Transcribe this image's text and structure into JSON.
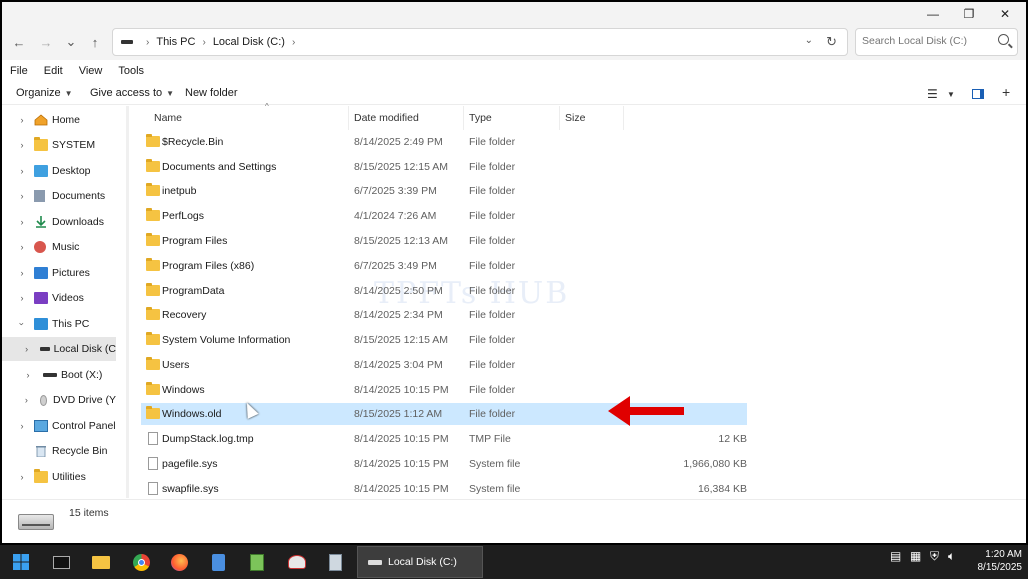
{
  "window": {
    "caption": {
      "minimize": "—",
      "maximize": "❐",
      "close": "✕"
    }
  },
  "nav": {
    "back": "←",
    "forward": "→",
    "recent": "⌄",
    "up": "↑"
  },
  "address": {
    "crumbs": [
      "This PC",
      "Local Disk (C:)"
    ],
    "separator": "›"
  },
  "search": {
    "placeholder": "Search Local Disk (C:)"
  },
  "menu": [
    "File",
    "Edit",
    "View",
    "Tools"
  ],
  "toolbar": {
    "organize": "Organize",
    "give_access": "Give access to",
    "new_folder": "New folder"
  },
  "sidebar": {
    "items": [
      {
        "label": "Home",
        "icon": "home-icon"
      },
      {
        "label": "SYSTEM",
        "icon": "folder-icon"
      },
      {
        "label": "Desktop",
        "icon": "desktop-icon"
      },
      {
        "label": "Documents",
        "icon": "documents-icon"
      },
      {
        "label": "Downloads",
        "icon": "downloads-icon"
      },
      {
        "label": "Music",
        "icon": "music-icon"
      },
      {
        "label": "Pictures",
        "icon": "pictures-icon"
      },
      {
        "label": "Videos",
        "icon": "videos-icon"
      },
      {
        "label": "This PC",
        "icon": "pc-icon"
      },
      {
        "label": "Local Disk (C",
        "icon": "drive-icon"
      },
      {
        "label": "Boot (X:)",
        "icon": "drive-icon"
      },
      {
        "label": "DVD Drive (Y",
        "icon": "dvd-icon"
      },
      {
        "label": "Control Panel",
        "icon": "control-panel-icon"
      },
      {
        "label": "Recycle Bin",
        "icon": "recycle-bin-icon"
      },
      {
        "label": "Utilities",
        "icon": "folder-icon"
      }
    ]
  },
  "columns": {
    "name": "Name",
    "date": "Date modified",
    "type": "Type",
    "size": "Size"
  },
  "files": [
    {
      "name": "$Recycle.Bin",
      "date": "8/14/2025 2:49 PM",
      "type": "File folder",
      "size": ""
    },
    {
      "name": "Documents and Settings",
      "date": "8/15/2025 12:15 AM",
      "type": "File folder",
      "size": ""
    },
    {
      "name": "inetpub",
      "date": "6/7/2025 3:39 PM",
      "type": "File folder",
      "size": ""
    },
    {
      "name": "PerfLogs",
      "date": "4/1/2024 7:26 AM",
      "type": "File folder",
      "size": ""
    },
    {
      "name": "Program Files",
      "date": "8/15/2025 12:13 AM",
      "type": "File folder",
      "size": ""
    },
    {
      "name": "Program Files (x86)",
      "date": "6/7/2025 3:49 PM",
      "type": "File folder",
      "size": ""
    },
    {
      "name": "ProgramData",
      "date": "8/14/2025 2:50 PM",
      "type": "File folder",
      "size": ""
    },
    {
      "name": "Recovery",
      "date": "8/14/2025 2:34 PM",
      "type": "File folder",
      "size": ""
    },
    {
      "name": "System Volume Information",
      "date": "8/15/2025 12:15 AM",
      "type": "File folder",
      "size": ""
    },
    {
      "name": "Users",
      "date": "8/14/2025 3:04 PM",
      "type": "File folder",
      "size": ""
    },
    {
      "name": "Windows",
      "date": "8/14/2025 10:15 PM",
      "type": "File folder",
      "size": ""
    },
    {
      "name": "Windows.old",
      "date": "8/15/2025 1:12 AM",
      "type": "File folder",
      "size": ""
    },
    {
      "name": "DumpStack.log.tmp",
      "date": "8/14/2025 10:15 PM",
      "type": "TMP File",
      "size": "12 KB"
    },
    {
      "name": "pagefile.sys",
      "date": "8/14/2025 10:15 PM",
      "type": "System file",
      "size": "1,966,080 KB"
    },
    {
      "name": "swapfile.sys",
      "date": "8/14/2025 10:15 PM",
      "type": "System file",
      "size": "16,384 KB"
    }
  ],
  "watermark": "TPFTs HUB",
  "status": {
    "count": "15 items"
  },
  "taskbar": {
    "window_label": "Local Disk (C:)",
    "time": "1:20 AM",
    "date": "8/15/2025"
  },
  "colors": {
    "selection": "#cce8ff",
    "arrow": "#e00000",
    "folder": "#f5c342"
  }
}
